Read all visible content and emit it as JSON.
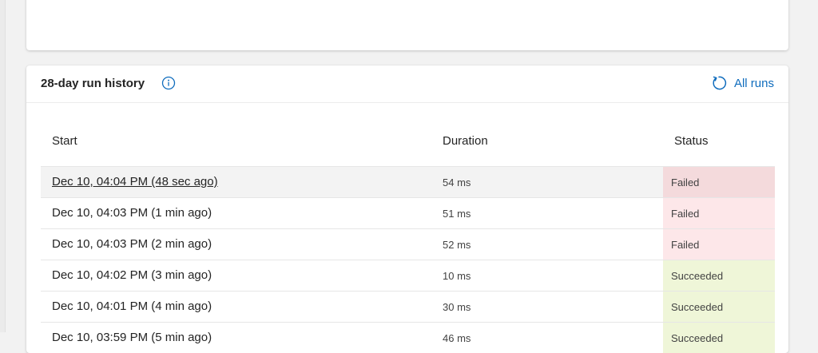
{
  "run_history": {
    "title": "28-day run history",
    "info_icon": "info-icon",
    "all_runs_label": "All runs",
    "all_runs_icon": "refresh-icon",
    "columns": [
      "Start",
      "Duration",
      "Status"
    ],
    "rows": [
      {
        "start": "Dec 10, 04:04 PM (48 sec ago)",
        "duration": "54 ms",
        "status": "Failed"
      },
      {
        "start": "Dec 10, 04:03 PM (1 min ago)",
        "duration": "51 ms",
        "status": "Failed"
      },
      {
        "start": "Dec 10, 04:03 PM (2 min ago)",
        "duration": "52 ms",
        "status": "Failed"
      },
      {
        "start": "Dec 10, 04:02 PM (3 min ago)",
        "duration": "10 ms",
        "status": "Succeeded"
      },
      {
        "start": "Dec 10, 04:01 PM (4 min ago)",
        "duration": "30 ms",
        "status": "Succeeded"
      },
      {
        "start": "Dec 10, 03:59 PM (5 min ago)",
        "duration": "46 ms",
        "status": "Succeeded"
      }
    ]
  },
  "colors": {
    "accent": "#0f6cbd",
    "failed_bg": "#fde7e9",
    "failed_bg_hover": "#f4dadc",
    "succeeded_bg": "#eff6d8"
  }
}
